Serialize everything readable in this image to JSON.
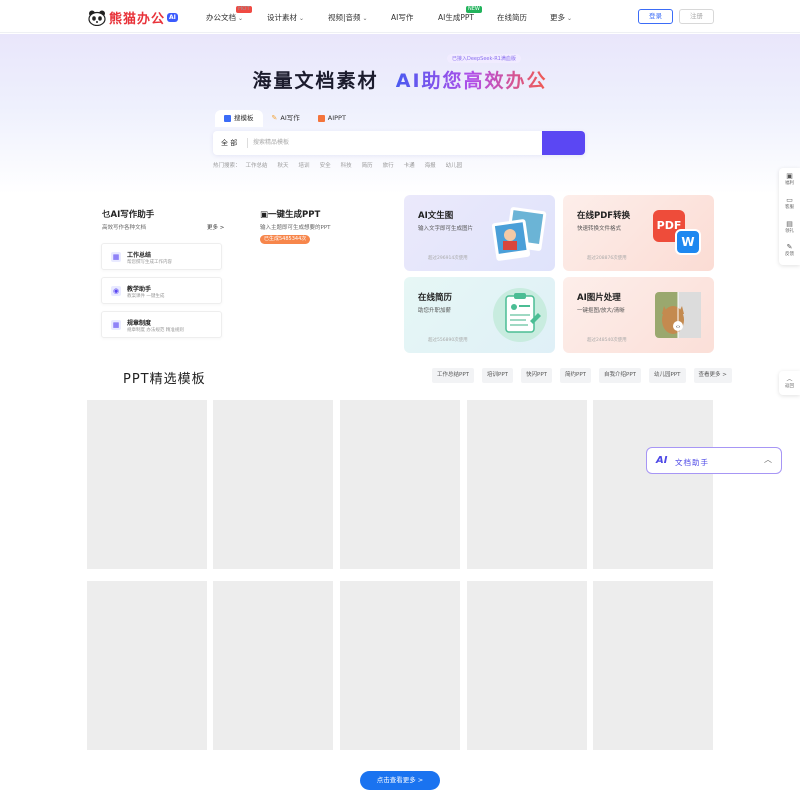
{
  "nav": {
    "logo_text": "熊猫办公",
    "logo_badge": "AI",
    "items": [
      {
        "label": "办公文档",
        "badge": "HOT"
      },
      {
        "label": "设计素材"
      },
      {
        "label": "视频|音频"
      },
      {
        "label": "AI写作"
      },
      {
        "label": "AI生成PPT",
        "badge": "NEW"
      },
      {
        "label": "在线简历"
      },
      {
        "label": "更多"
      }
    ],
    "login": "登录",
    "register": "注册"
  },
  "hero": {
    "tag": "已接入DeepSeek-R1满血版",
    "title_plain": "海量文档素材",
    "title_grad": "AI助您高效办公",
    "tabs": [
      "搜模板",
      "AI写作",
      "AIPPT"
    ],
    "search_scope": "全 部",
    "search_placeholder": "搜索精品模板",
    "hot_label": "热门搜索：",
    "hot_words": [
      "工作总结",
      "秋天",
      "培训",
      "安全",
      "科技",
      "简历",
      "旅行",
      "卡通",
      "海报",
      "幼儿园"
    ]
  },
  "side": [
    "福利",
    "客服",
    "领礼",
    "反馈"
  ],
  "side_top": "返回",
  "ai_write": {
    "title": "AI写作助手",
    "sub": "高效写作各种文档",
    "more": "更多 >",
    "items": [
      {
        "name": "工作总结",
        "desc": "帮您撰写生成工作内容"
      },
      {
        "name": "教学助手",
        "desc": "教案课件 一键生成"
      },
      {
        "name": "规章制度",
        "desc": "规章制度 办法规范 精准规则"
      }
    ]
  },
  "ppt_gen": {
    "title": "一键生成PPT",
    "sub": "输入主题即可生成想要的PPT",
    "badge": "已生成5485344次"
  },
  "features": [
    {
      "title": "AI文生图",
      "desc": "输入文字即可生成图片",
      "count": "超过296914次使用"
    },
    {
      "title": "在线PDF转换",
      "desc": "快速转换文件格式",
      "count": "超过208876次使用"
    },
    {
      "title": "在线简历",
      "desc": "助您升职加薪",
      "count": "超过556890次使用"
    },
    {
      "title": "AI图片处理",
      "desc": "一键抠图/放大/清晰",
      "count": "超过248540次使用"
    }
  ],
  "pdf_letters": {
    "pdf": "PDF",
    "w": "W"
  },
  "ppt_section": {
    "title": "PPT精选模板",
    "filters": [
      "工作总结PPT",
      "培训PPT",
      "快闪PPT",
      "简约PPT",
      "自我介绍PPT",
      "幼儿园PPT",
      "查看更多 >"
    ]
  },
  "assistant": {
    "ai": "AI",
    "label": "文档助手"
  },
  "more_button": "点击查看更多 >"
}
